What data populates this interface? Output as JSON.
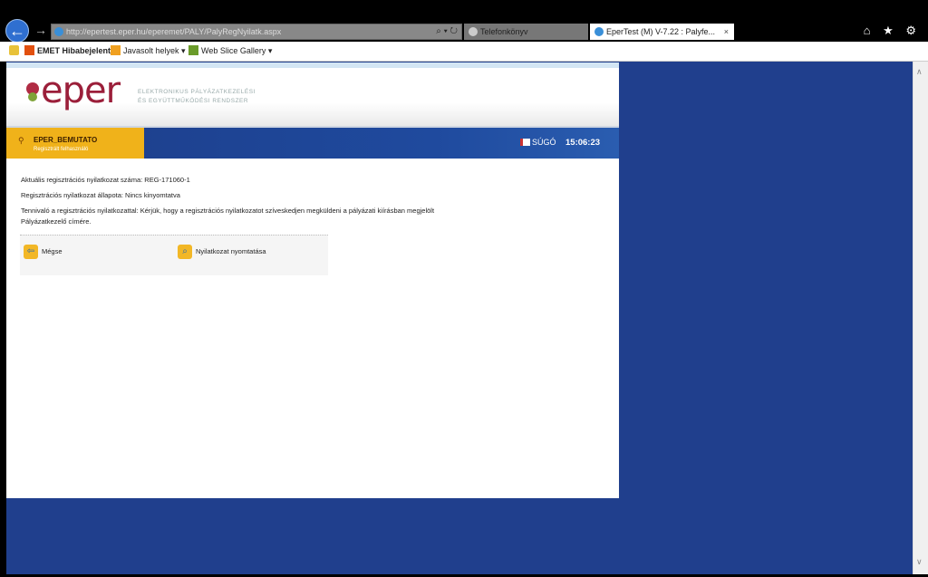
{
  "browser": {
    "url": "http://epertest.eper.hu/eperemet/PALY/PalyRegNyilatk.aspx",
    "tabs": [
      {
        "label": "Telefonkönyv"
      },
      {
        "label": "EperTest (M) V-7.22 : Palyfe..."
      }
    ],
    "tab_close": "×",
    "address_controls": "⌕ ▾ ↻",
    "toolbar_icons": "⌂ ★ ⚙",
    "back_icon": "←",
    "forward_icon": "→"
  },
  "favorites": [
    {
      "label": "EMET Hibabejelentő",
      "color": "#e2500f"
    },
    {
      "label": "Javasolt helyek ▾",
      "color": "#f0a020"
    },
    {
      "label": "Web Slice Gallery ▾",
      "color": "#6a9b2a"
    }
  ],
  "app": {
    "logo": "eper",
    "logo_subtitle_1": "ELEKTRONIKUS PÁLYÁZATKEZELÉSI",
    "logo_subtitle_2": "ÉS EGYÜTTMŰKÖDÉSI RENDSZER",
    "user_name": "EPER_BEMUTATO",
    "user_role": "Regisztrált felhasználó",
    "help_label": "SÚGÓ",
    "clock": "15:06:23"
  },
  "main": {
    "reg_number": "Aktuális regisztrációs nyilatkozat száma: REG-171060-1",
    "reg_status": "Regisztrációs nyilatkozat állapota: Nincs kinyomtatva",
    "todo": "Tennivaló a regisztrációs nyilatkozattal: Kérjük, hogy a regisztrációs nyilatkozatot szíveskedjen megküldeni a pályázati kiírásban megjelölt Pályázatkezelő címére.",
    "cancel_label": "Mégse",
    "print_label": "Nyilatkozat nyomtatása"
  },
  "colors": {
    "accent_blue": "#203f8d",
    "user_box": "#f0b21a",
    "brand": "#9b1f3a"
  }
}
